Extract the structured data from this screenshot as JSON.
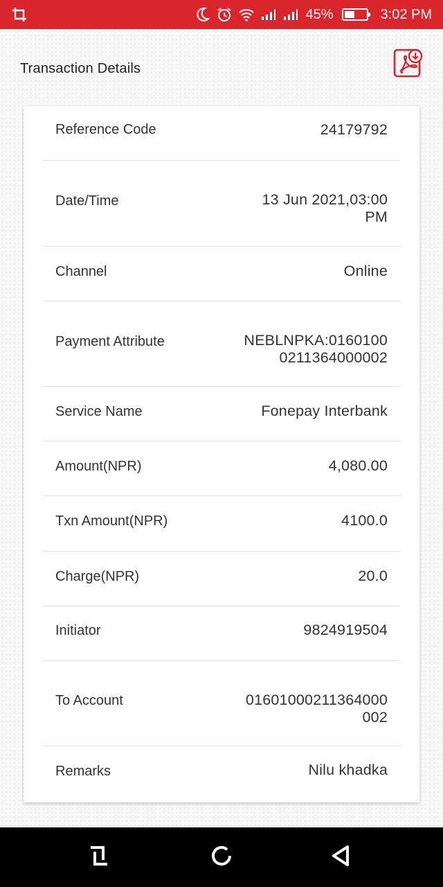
{
  "status_bar": {
    "battery": "45%",
    "time": "3:02 PM",
    "icons": [
      "screenshot-icon",
      "moon-icon",
      "alarm-icon",
      "wifi-icon",
      "signal-icon",
      "signal-icon",
      "battery-icon"
    ]
  },
  "header": {
    "title": "Transaction Details",
    "pdf_icon": "pdf-download-icon"
  },
  "details": [
    {
      "label": "Reference Code",
      "value": "24179792"
    },
    {
      "label": "Date/Time",
      "value": "13 Jun 2021,03:00 PM"
    },
    {
      "label": "Channel",
      "value": "Online"
    },
    {
      "label": "Payment Attribute",
      "value": "NEBLNPKA:0160100 0211364000002"
    },
    {
      "label": "Service Name",
      "value": "Fonepay Interbank"
    },
    {
      "label": "Amount(NPR)",
      "value": "4,080.00"
    },
    {
      "label": "Txn Amount(NPR)",
      "value": "4100.0"
    },
    {
      "label": "Charge(NPR)",
      "value": "20.0"
    },
    {
      "label": "Initiator",
      "value": "9824919504"
    },
    {
      "label": "To Account",
      "value": "01601000211364000 002"
    },
    {
      "label": "Remarks",
      "value": "Nilu khadka"
    }
  ],
  "nav_bar": {
    "icons": [
      "recents-icon",
      "home-icon",
      "back-icon"
    ]
  },
  "colors": {
    "accent": "#d9262c",
    "text": "#333333",
    "divider": "#e2e2e2"
  }
}
